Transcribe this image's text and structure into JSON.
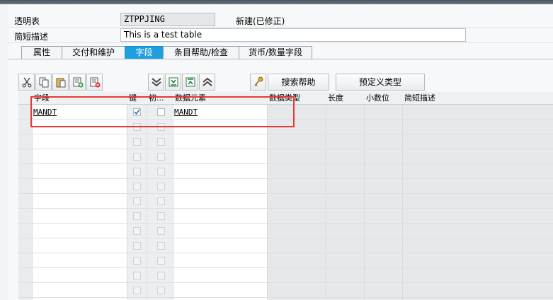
{
  "form": {
    "table_label": "透明表",
    "table_name": "ZTPPJING",
    "status": "新建(已修正)",
    "desc_label": "简短描述",
    "desc_value": "This is  a test table"
  },
  "tabs": [
    {
      "label": "属性"
    },
    {
      "label": "交付和维护"
    },
    {
      "label": "字段"
    },
    {
      "label": "条目帮助/检查"
    },
    {
      "label": "货币/数量字段"
    }
  ],
  "toolbar": {
    "search_help": "搜索帮助",
    "predefined_type": "预定义类型"
  },
  "columns": [
    "字段",
    "键",
    "初...",
    "数据元素",
    "数据类型",
    "长度",
    "小数位",
    "简短描述"
  ],
  "rows": [
    {
      "field": "MANDT",
      "key": true,
      "init": false,
      "data_element": "MANDT"
    }
  ],
  "colors": {
    "active_tab": "#1f9fe0",
    "highlight": "#e63a3a"
  }
}
